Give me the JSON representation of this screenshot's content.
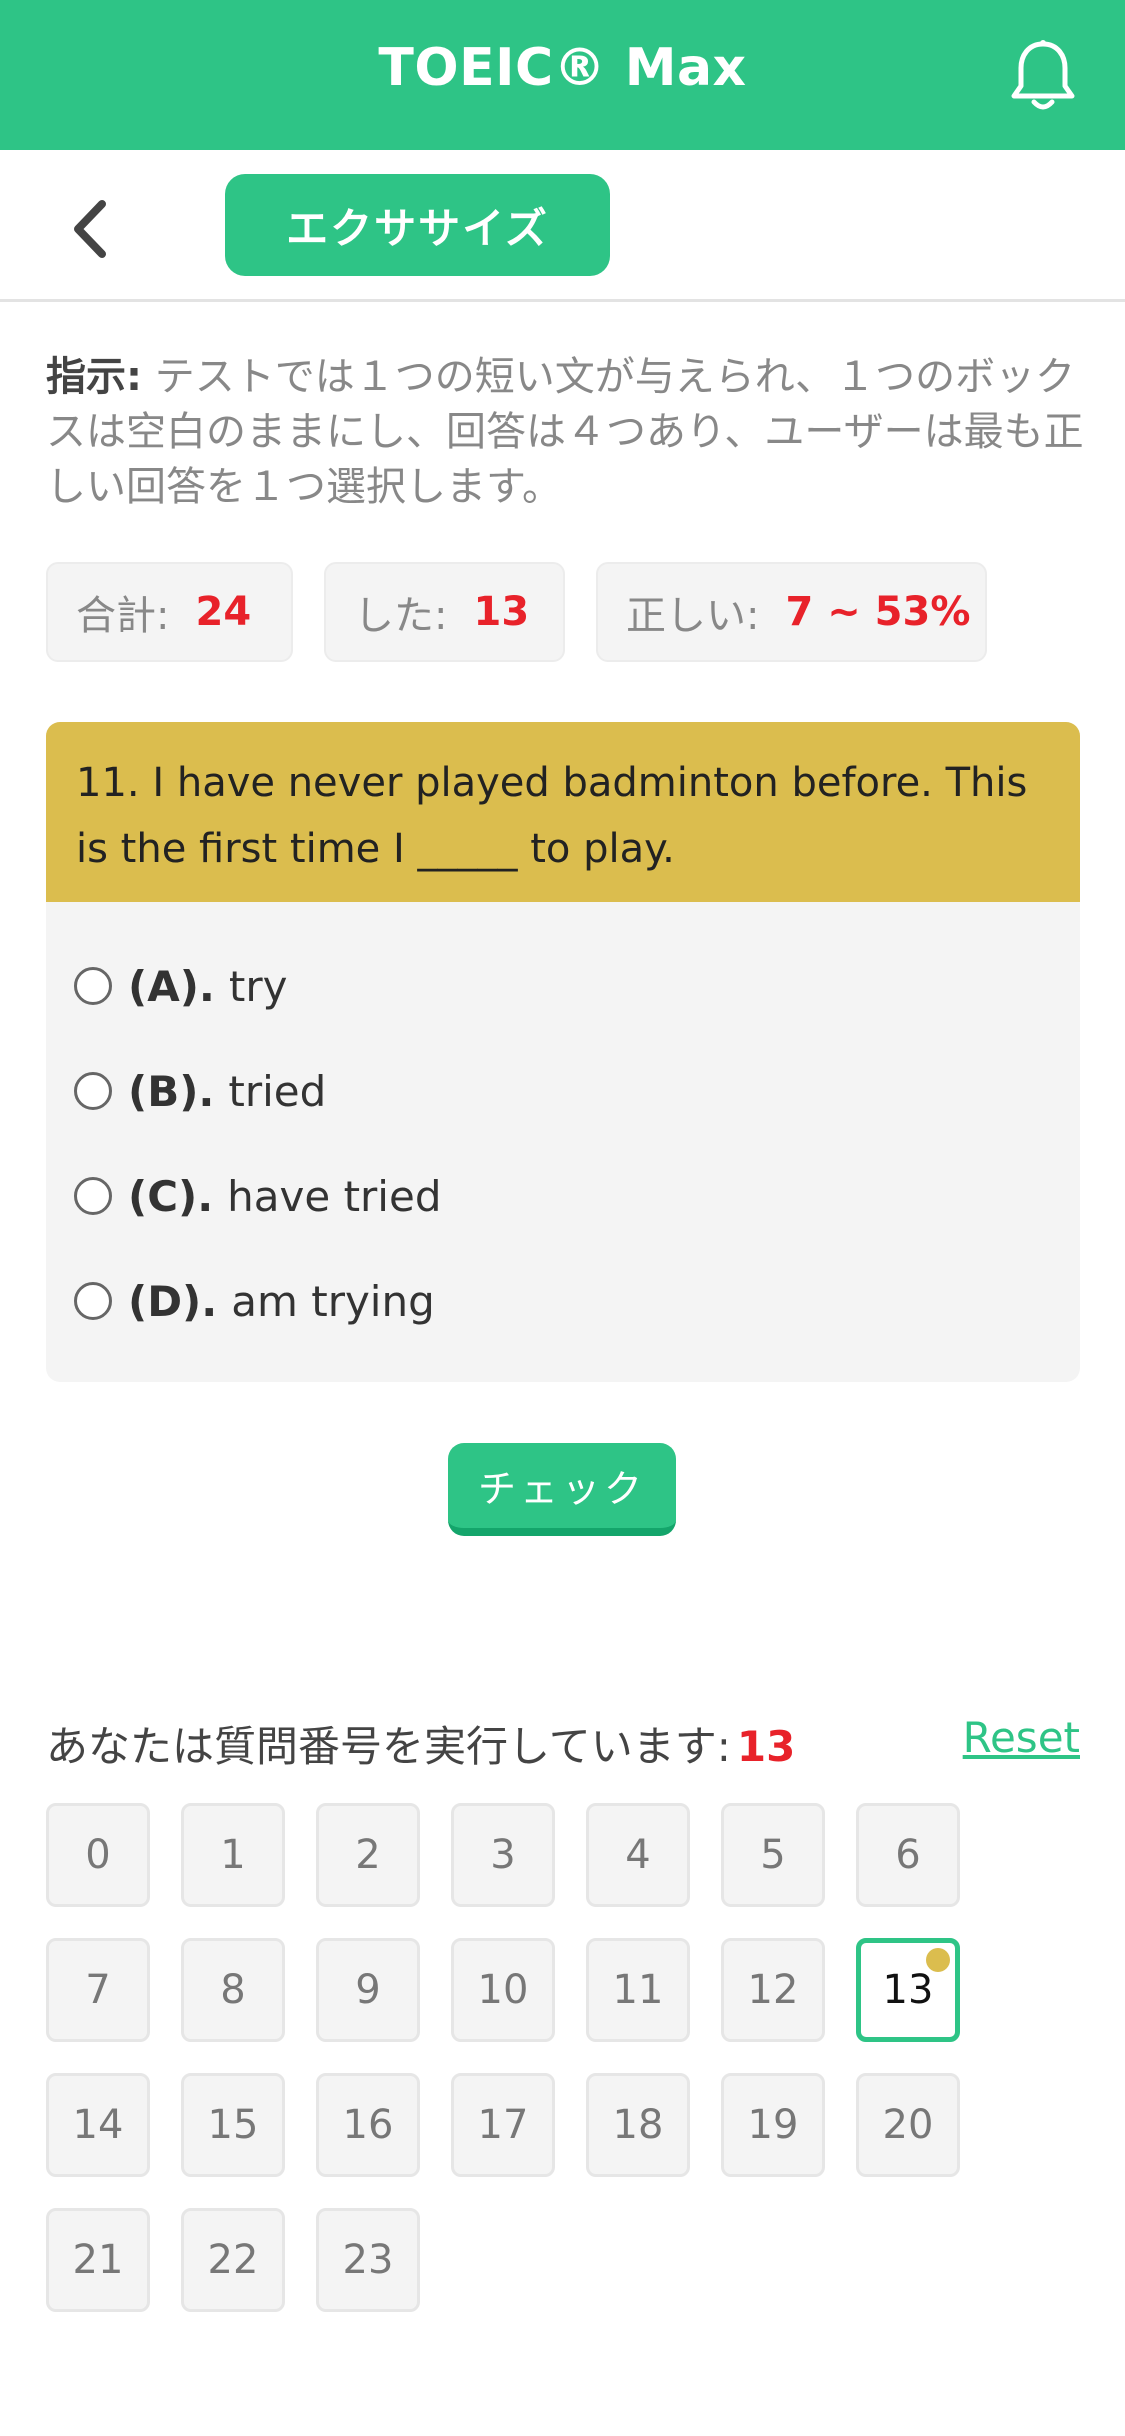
{
  "header": {
    "title": "TOEIC® Max"
  },
  "subbar": {
    "exercise_label": "エクササイズ"
  },
  "instructions": {
    "label": "指示:",
    "text": " テストでは１つの短い文が与えられ、１つのボックスは空白のままにし、回答は４つあり、ユーザーは最も正しい回答を１つ選択します。"
  },
  "stats": {
    "total_label": "合計:",
    "total_value": "24",
    "done_label": "した:",
    "done_value": "13",
    "correct_label": "正しい:",
    "correct_value": "7 ~ 53%"
  },
  "question": {
    "text": "11. I have never played badminton before. This is the first time I _____ to play.",
    "options": [
      {
        "label": "(A).",
        "text": "try"
      },
      {
        "label": "(B).",
        "text": "tried"
      },
      {
        "label": "(C).",
        "text": "have tried"
      },
      {
        "label": "(D).",
        "text": "am trying"
      }
    ]
  },
  "check_label": "チェック",
  "progress": {
    "label": "あなたは質問番号を実行しています:",
    "current": "13",
    "reset_label": "Reset"
  },
  "numbers": [
    "0",
    "1",
    "2",
    "3",
    "4",
    "5",
    "6",
    "7",
    "8",
    "9",
    "10",
    "11",
    "12",
    "13",
    "14",
    "15",
    "16",
    "17",
    "18",
    "19",
    "20",
    "21",
    "22",
    "23"
  ],
  "colors": {
    "brand": "#2ec486",
    "question_header": "#dbbd4e",
    "highlight": "#e8222a"
  }
}
